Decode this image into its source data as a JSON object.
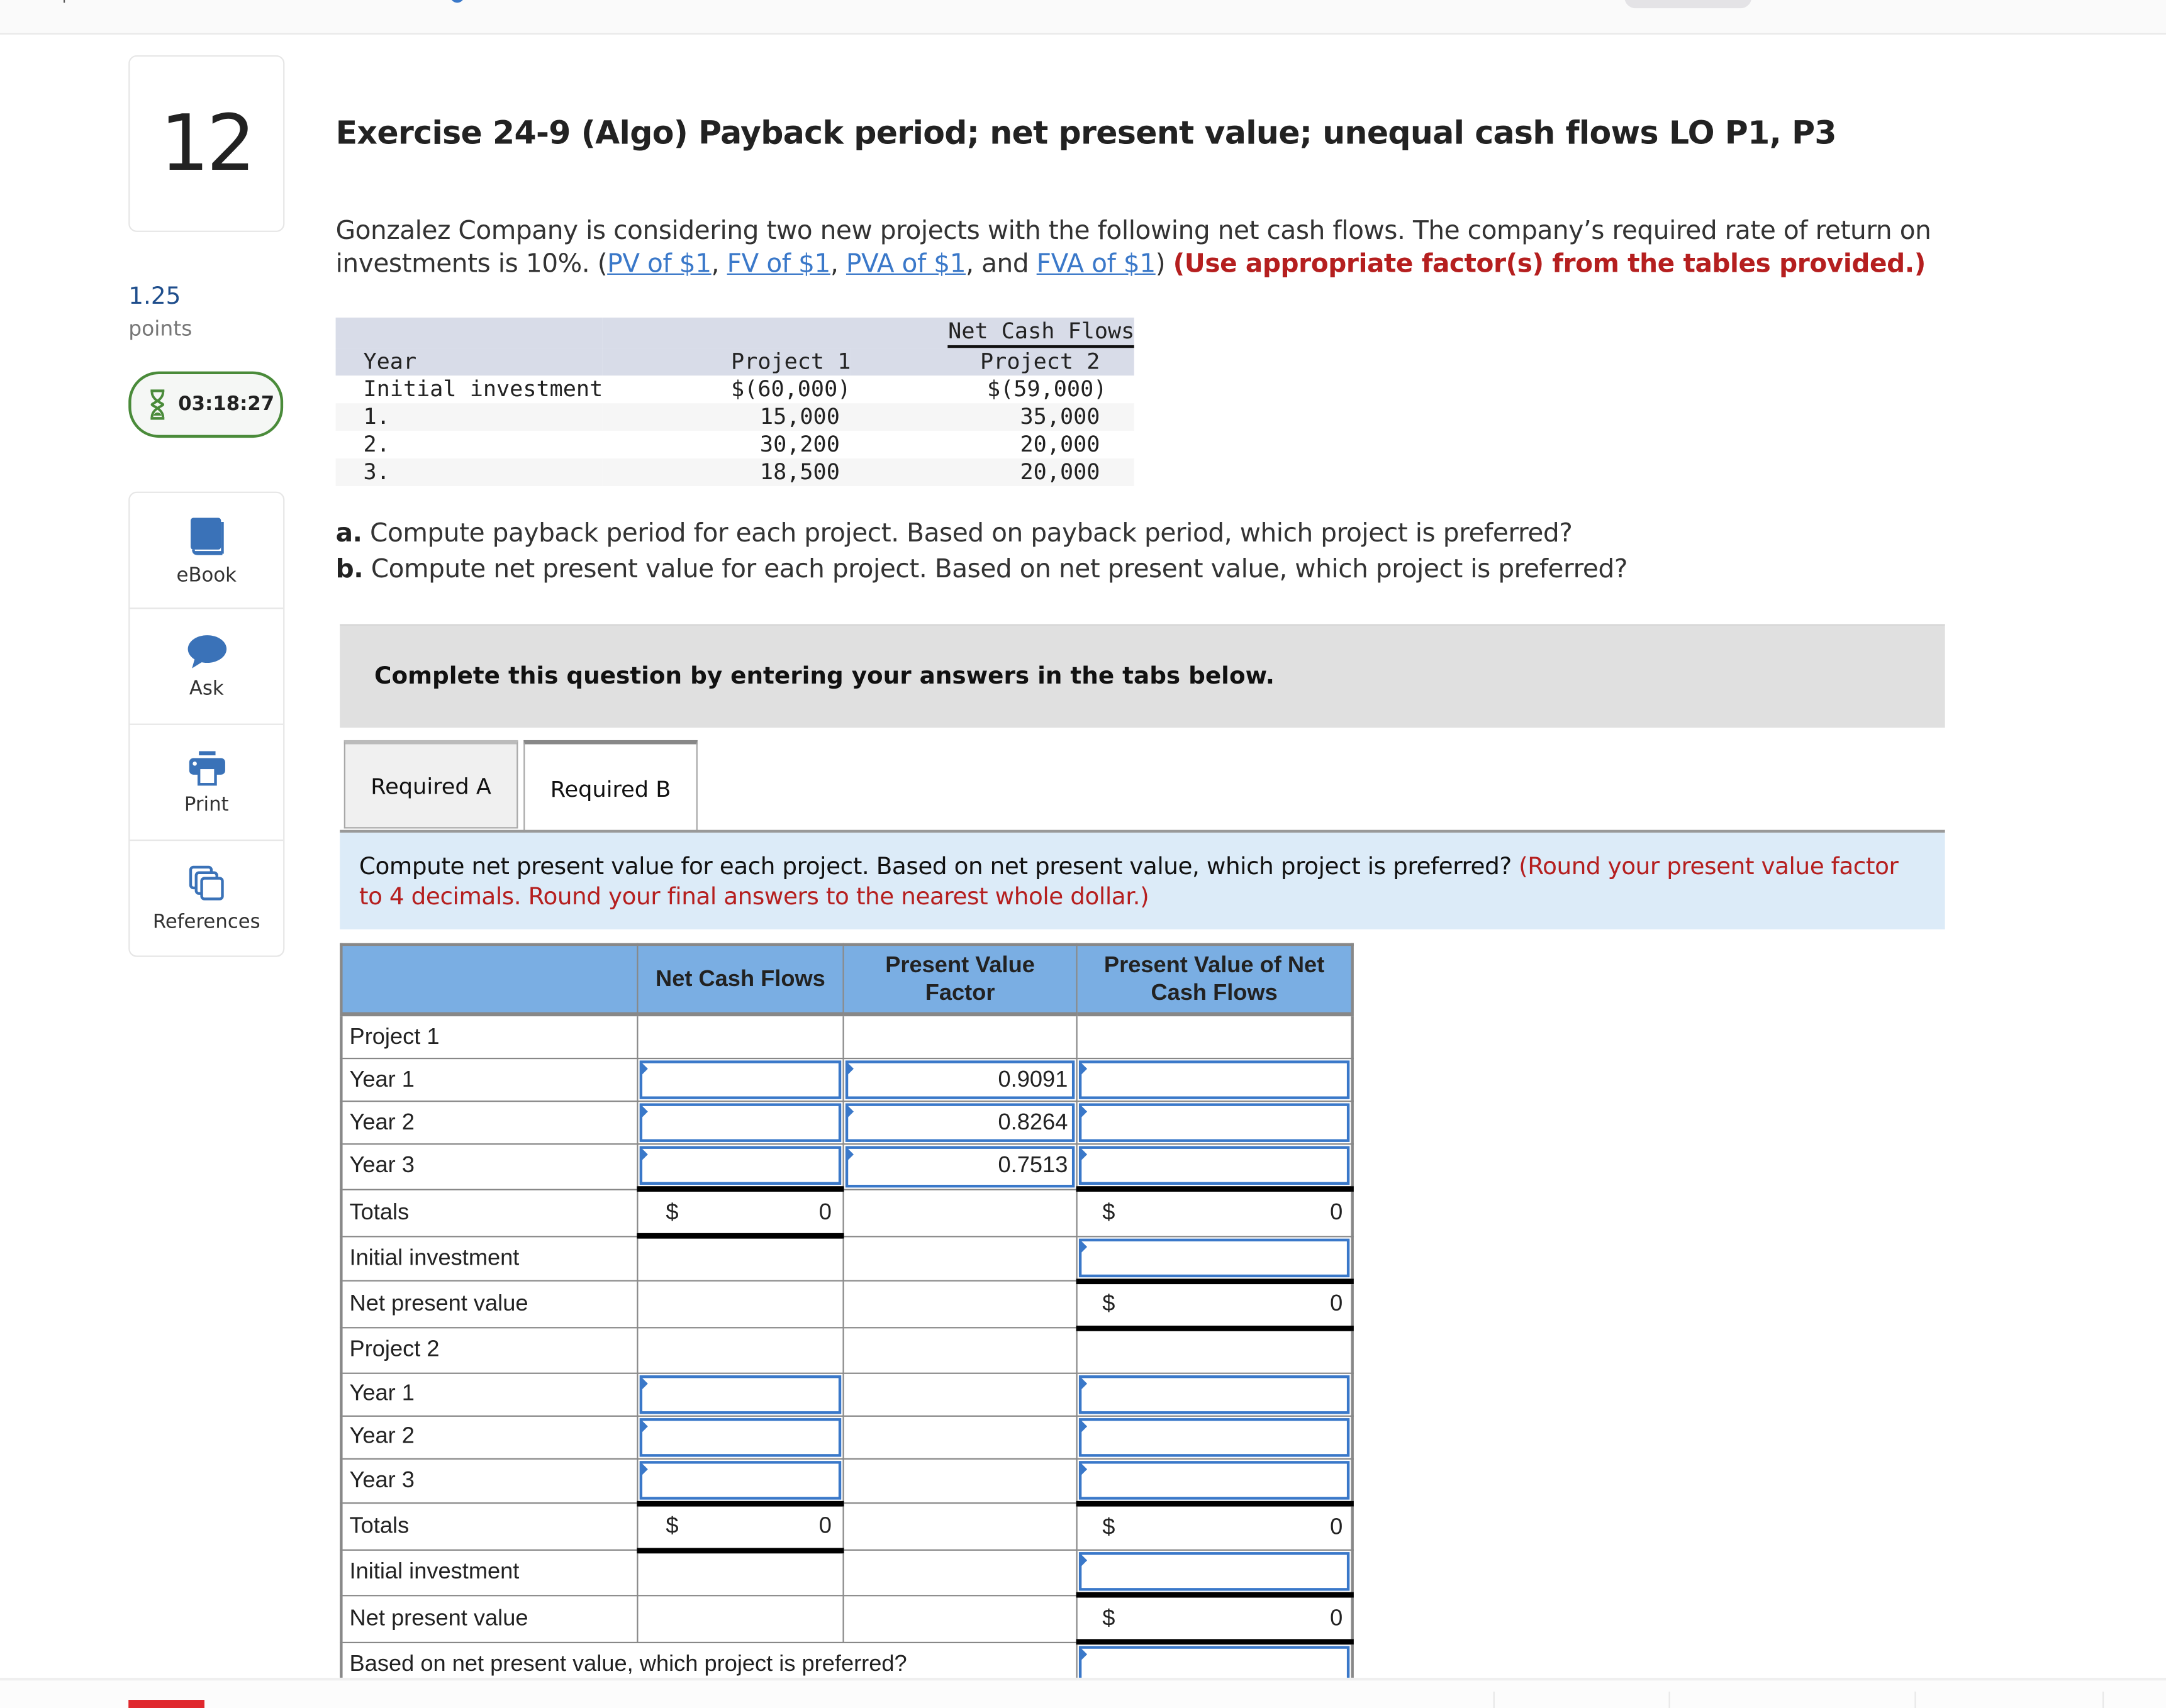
{
  "question": {
    "number": "12",
    "points_value": "1.25",
    "points_label": "points",
    "timer": "03:18:27",
    "title": "Exercise 24-9 (Algo) Payback period; net present value; unequal cash flows LO P1, P3",
    "intro_text": "Gonzalez Company is considering two new projects with the following net cash flows. The company’s required rate of return on investments is 10%. (",
    "links": [
      "PV of $1",
      "FV of $1",
      "PVA of $1",
      "FVA of $1"
    ],
    "link_sep_comma": ", ",
    "link_sep_and": ", and ",
    "intro_close": ")",
    "intro_instruction": "(Use appropriate factor(s) from the tables provided.)",
    "part_a_label": "a.",
    "part_a_text": " Compute payback period for each project. Based on payback period, which project is preferred?",
    "part_b_label": "b.",
    "part_b_text": " Compute net present value for each project. Based on net present value, which project is preferred?"
  },
  "sidebar_tools": [
    {
      "label": "eBook",
      "icon": "book-icon"
    },
    {
      "label": "Ask",
      "icon": "speech-bubble-icon"
    },
    {
      "label": "Print",
      "icon": "printer-icon"
    },
    {
      "label": "References",
      "icon": "documents-icon"
    }
  ],
  "given_table": {
    "group_header": "Net Cash Flows",
    "col_year": "Year",
    "col_p1": "Project 1",
    "col_p2": "Project 2",
    "rows": [
      {
        "year": "Initial investment",
        "p1": "$(60,000)",
        "p2": "$(59,000)"
      },
      {
        "year": "1.",
        "p1": "15,000",
        "p2": "35,000"
      },
      {
        "year": "2.",
        "p1": "30,200",
        "p2": "20,000"
      },
      {
        "year": "3.",
        "p1": "18,500",
        "p2": "20,000"
      }
    ]
  },
  "instruction_banner": "Complete this question by entering your answers in the tabs below.",
  "tabs": [
    {
      "label": "Required A",
      "active": false
    },
    {
      "label": "Required B",
      "active": true
    }
  ],
  "tab_prompt": {
    "text": "Compute net present value for each project. Based on net present value, which project is preferred? ",
    "note": "(Round your present value factor to 4 decimals. Round your final answers to the nearest whole dollar.)"
  },
  "npv_table": {
    "headers": [
      "",
      "Net Cash Flows",
      "Present Value Factor",
      "Present Value of Net Cash Flows"
    ],
    "currency": "$",
    "project1": {
      "label": "Project 1",
      "years": [
        {
          "label": "Year 1",
          "cash_flow": "",
          "factor": "0.9091",
          "pv": ""
        },
        {
          "label": "Year 2",
          "cash_flow": "",
          "factor": "0.8264",
          "pv": ""
        },
        {
          "label": "Year 3",
          "cash_flow": "",
          "factor": "0.7513",
          "pv": ""
        }
      ],
      "totals_label": "Totals",
      "total_cash_flow": "0",
      "total_pv": "0",
      "initial_label": "Initial investment",
      "initial_value": "",
      "npv_label": "Net present value",
      "npv_value": "0"
    },
    "project2": {
      "label": "Project 2",
      "years": [
        {
          "label": "Year 1",
          "cash_flow": "",
          "pv": ""
        },
        {
          "label": "Year 2",
          "cash_flow": "",
          "pv": ""
        },
        {
          "label": "Year 3",
          "cash_flow": "",
          "pv": ""
        }
      ],
      "totals_label": "Totals",
      "total_cash_flow": "0",
      "total_pv": "0",
      "initial_label": "Initial investment",
      "initial_value": "",
      "npv_label": "Net present value",
      "npv_value": "0"
    },
    "preferred_label": "Based on net present value, which project is preferred?",
    "preferred_value": ""
  }
}
